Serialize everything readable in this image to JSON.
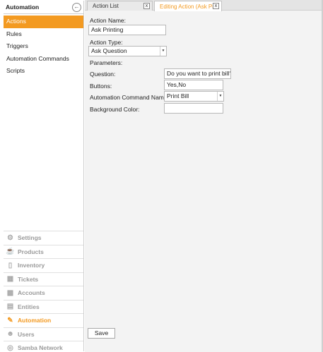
{
  "sidebar": {
    "title": "Automation",
    "items": [
      "Actions",
      "Rules",
      "Triggers",
      "Automation Commands",
      "Scripts"
    ],
    "nav": [
      {
        "label": "Settings",
        "icon": "gear-icon"
      },
      {
        "label": "Products",
        "icon": "cup-icon"
      },
      {
        "label": "Inventory",
        "icon": "box-icon"
      },
      {
        "label": "Tickets",
        "icon": "ticket-icon"
      },
      {
        "label": "Accounts",
        "icon": "calculator-icon"
      },
      {
        "label": "Entities",
        "icon": "grid-icon"
      },
      {
        "label": "Automation",
        "icon": "pencil-icon"
      },
      {
        "label": "Users",
        "icon": "user-icon"
      },
      {
        "label": "Samba Network",
        "icon": "globe-icon"
      }
    ]
  },
  "tabs": [
    {
      "label": "Action List",
      "close": "x"
    },
    {
      "label": "Editing Action (Ask Pr",
      "close": "x"
    }
  ],
  "form": {
    "action_name_label": "Action Name:",
    "action_name_value": "Ask Printing",
    "action_type_label": "Action Type:",
    "action_type_value": "Ask Question",
    "parameters_label": "Parameters:",
    "question_label": "Question:",
    "question_value": "Do you want to print bill?",
    "buttons_label": "Buttons:",
    "buttons_value": "Yes,No",
    "command_label": "Automation Command Name:",
    "command_value": "Print Bill",
    "bgcolor_label": "Background Color:",
    "bgcolor_value": "",
    "save_label": "Save"
  },
  "colors": {
    "accent": "#f39a21"
  }
}
